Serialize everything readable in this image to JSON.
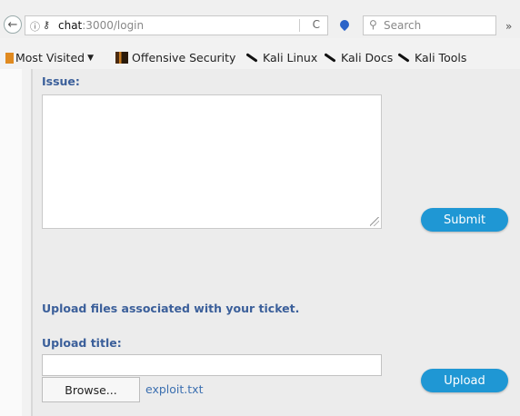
{
  "browser": {
    "url_host": "chat",
    "url_path": ":3000/login",
    "search_placeholder": "Search",
    "back_icon": "←",
    "reload_icon": "C",
    "overflow_icon": "»"
  },
  "bookmarks": [
    {
      "label": "Most Visited",
      "icon": "folder-icon"
    },
    {
      "label": "Offensive Security",
      "icon": "offensive-security-icon"
    },
    {
      "label": "Kali Linux",
      "icon": "kali-dragon-icon"
    },
    {
      "label": "Kali Docs",
      "icon": "kali-dragon-icon"
    },
    {
      "label": "Kali Tools",
      "icon": "kali-dragon-icon"
    }
  ],
  "form": {
    "issue_label": "Issue:",
    "issue_value": "",
    "submit_label": "Submit",
    "upload_heading": "Upload files associated with your ticket.",
    "upload_title_label": "Upload title:",
    "upload_title_value": "",
    "browse_label": "Browse...",
    "selected_file": "exploit.txt",
    "upload_label": "Upload"
  },
  "colors": {
    "accent_button": "#1f97d4",
    "label_text": "#3b5f9a"
  }
}
